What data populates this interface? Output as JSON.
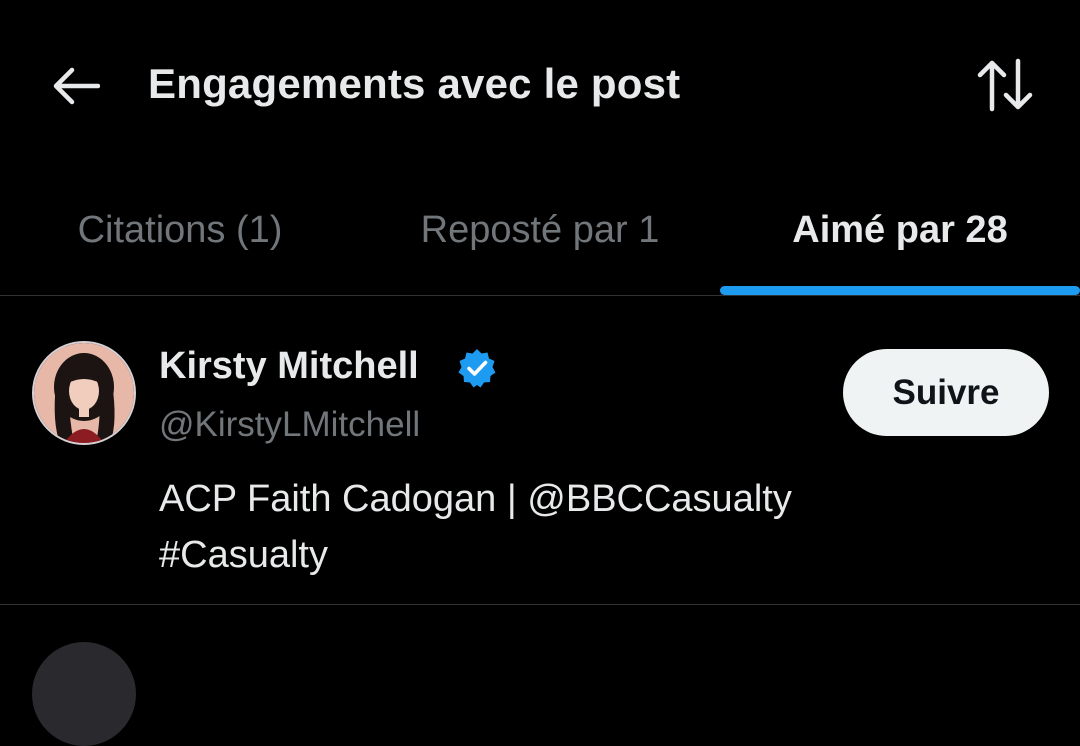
{
  "header": {
    "back_icon": "arrow-left-icon",
    "title": "Engagements avec le post",
    "sort_icon": "sort-arrows-icon"
  },
  "tabs": [
    {
      "label": "Citations (1)",
      "active": false
    },
    {
      "label": "Reposté par 1",
      "active": false
    },
    {
      "label": "Aimé par 28",
      "active": true
    }
  ],
  "users": [
    {
      "name": "Kirsty Mitchell",
      "verified": true,
      "handle": "@KirstyLMitchell",
      "follow_label": "Suivre",
      "bio_lines": [
        "ACP Faith Cadogan | @BBCCasualty",
        "#Casualty"
      ]
    }
  ],
  "colors": {
    "background": "#000000",
    "text_primary": "#e7e9ea",
    "text_secondary": "#71767b",
    "accent": "#1d9bf0",
    "divider": "#2f3336",
    "follow_button_bg": "#eff3f4"
  }
}
